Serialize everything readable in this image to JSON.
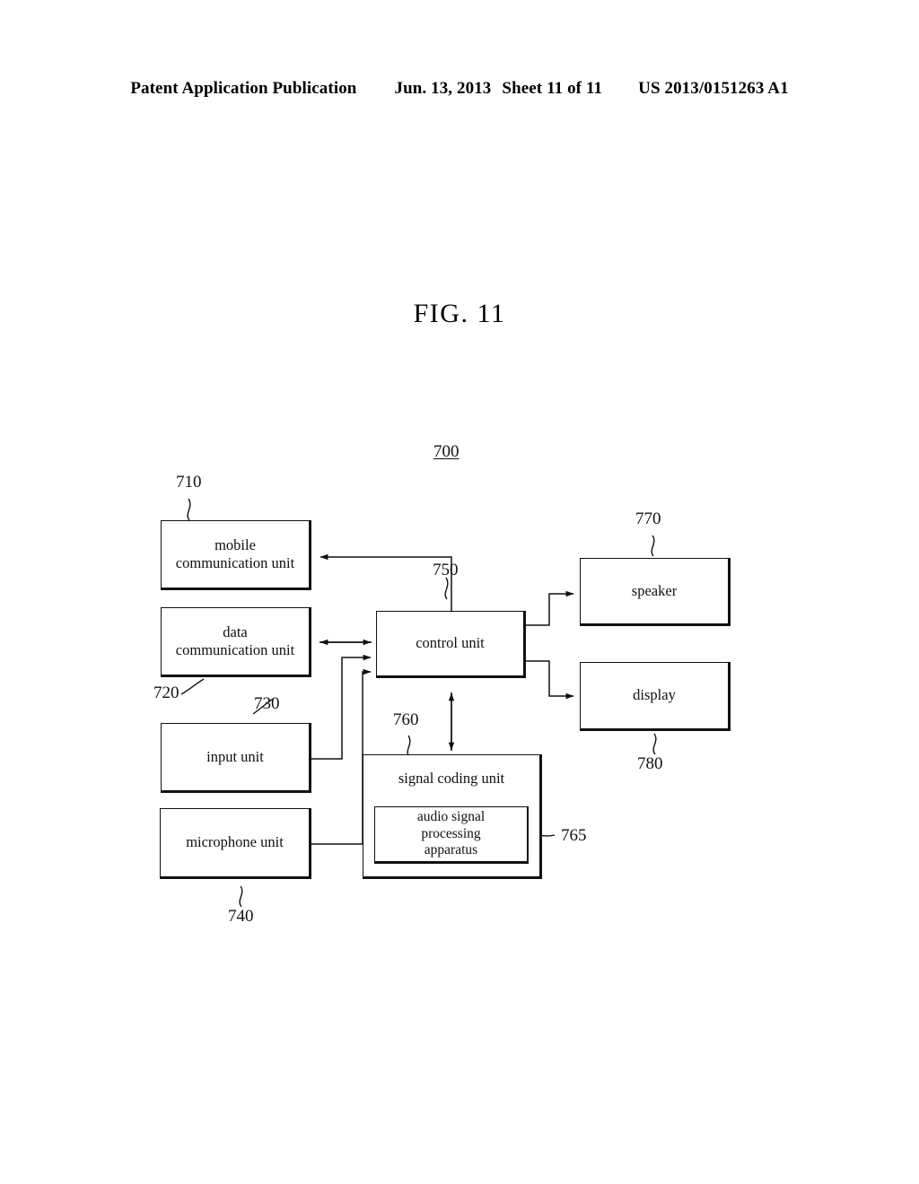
{
  "header": {
    "publication": "Patent Application Publication",
    "date": "Jun. 13, 2013",
    "sheet": "Sheet 11 of 11",
    "patent_number": "US 2013/0151263 A1"
  },
  "figure": {
    "title": "FIG. 11",
    "system_ref": "700"
  },
  "blocks": [
    {
      "id": "mobile-communication-unit",
      "label": "mobile\ncommunication unit",
      "ref": "710"
    },
    {
      "id": "data-communication-unit",
      "label": "data\ncommunication unit",
      "ref": "720"
    },
    {
      "id": "input-unit",
      "label": "input unit",
      "ref": "730"
    },
    {
      "id": "microphone-unit",
      "label": "microphone unit",
      "ref": "740"
    },
    {
      "id": "control-unit",
      "label": "control unit",
      "ref": "750"
    },
    {
      "id": "signal-coding-unit",
      "label": "signal coding unit",
      "ref": "760"
    },
    {
      "id": "audio-signal-processing-apparatus",
      "label": "audio signal\nprocessing\napparatus",
      "ref": "765"
    },
    {
      "id": "speaker",
      "label": "speaker",
      "ref": "770"
    },
    {
      "id": "display",
      "label": "display",
      "ref": "780"
    }
  ],
  "block_labels": {
    "mobile_communication_unit_line1": "mobile",
    "mobile_communication_unit_line2": "communication unit",
    "data_communication_unit_line1": "data",
    "data_communication_unit_line2": "communication unit",
    "input_unit": "input unit",
    "microphone_unit": "microphone unit",
    "control_unit": "control unit",
    "signal_coding_unit": "signal coding unit",
    "audio_apparatus_line1": "audio signal",
    "audio_apparatus_line2": "processing",
    "audio_apparatus_line3": "apparatus",
    "speaker": "speaker",
    "display": "display"
  },
  "refs": {
    "system": "700",
    "mobile_communication_unit": "710",
    "data_communication_unit": "720",
    "input_unit": "730",
    "microphone_unit": "740",
    "control_unit": "750",
    "signal_coding_unit": "760",
    "audio_signal_processing_apparatus": "765",
    "speaker": "770",
    "display": "780"
  },
  "colors": {
    "ink": "#111111",
    "paper": "#ffffff"
  }
}
